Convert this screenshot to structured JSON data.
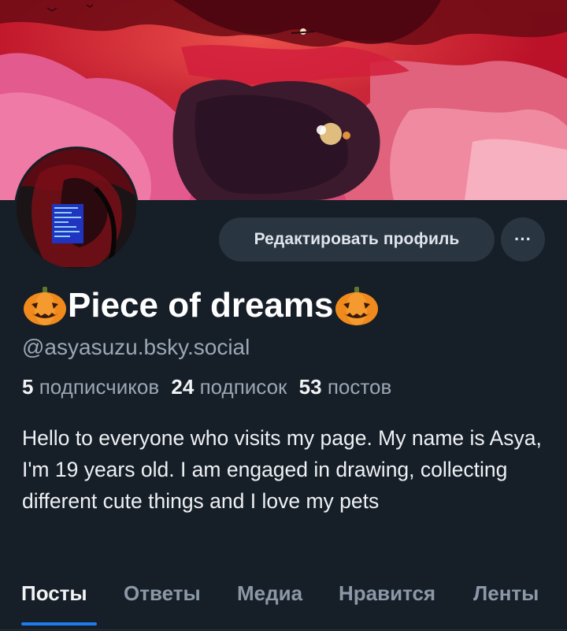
{
  "profile": {
    "display_name": "Piece of dreams",
    "handle": "@asyasuzu.bsky.social",
    "name_emoji": "pumpkin-icon",
    "stats": {
      "followers_count": "5",
      "followers_label": "подписчиков",
      "following_count": "24",
      "following_label": "подписок",
      "posts_count": "53",
      "posts_label": "постов"
    },
    "bio": "Hello to everyone who visits my page. My name is Asya, I'm 19 years old. I am engaged in drawing, collecting different cute things and I love my pets"
  },
  "actions": {
    "edit_profile_label": "Редактировать профиль",
    "more_label": "···"
  },
  "tabs": [
    {
      "label": "Посты",
      "active": true
    },
    {
      "label": "Ответы",
      "active": false
    },
    {
      "label": "Медиа",
      "active": false
    },
    {
      "label": "Нравится",
      "active": false
    },
    {
      "label": "Ленты",
      "active": false
    }
  ],
  "colors": {
    "background": "#161e27",
    "accent": "#1f7cf0",
    "button_bg": "#2a3542",
    "muted_text": "#9aa7b5"
  }
}
